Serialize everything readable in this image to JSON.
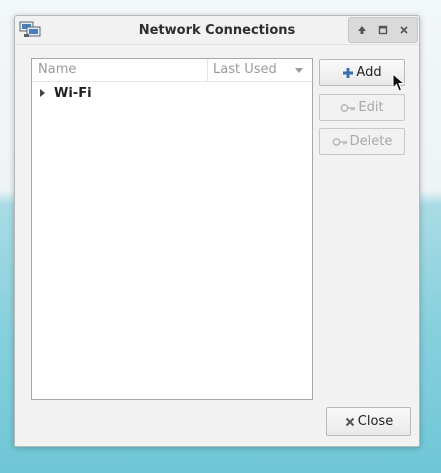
{
  "window": {
    "title": "Network Connections"
  },
  "list": {
    "columns": [
      "Name",
      "Last Used"
    ],
    "groups": [
      {
        "label": "Wi-Fi"
      }
    ]
  },
  "actions": {
    "add": "Add",
    "edit": "Edit",
    "delete": "Delete",
    "close": "Close"
  },
  "icons": {
    "app": "network-icon",
    "add": "plus-icon",
    "edit": "key-icon",
    "delete": "key-icon",
    "close": "close-icon"
  },
  "colors": {
    "plus_icon": "#3a6fb0",
    "close_icon": "#555555"
  }
}
